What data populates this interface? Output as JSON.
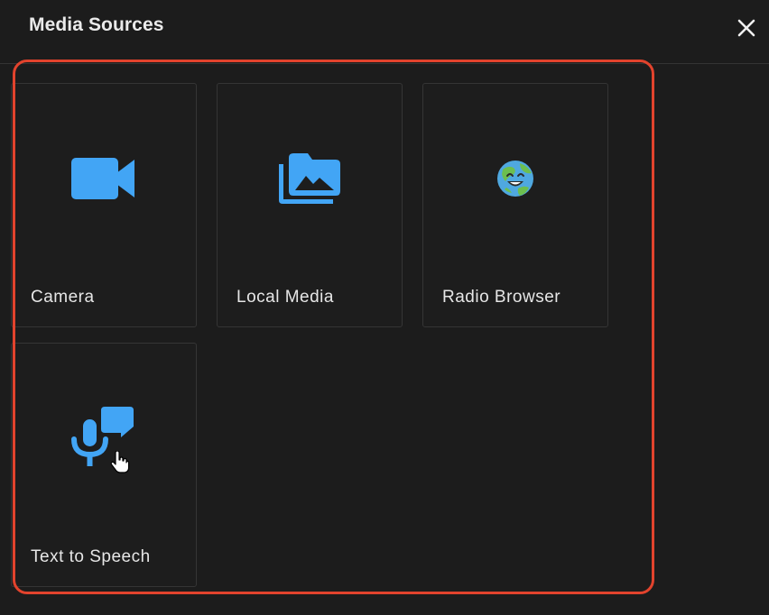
{
  "dialog": {
    "title": "Media Sources",
    "close_icon": "close-icon"
  },
  "sources": [
    {
      "label": "Camera",
      "icon": "videocam-icon"
    },
    {
      "label": "Local Media",
      "icon": "photo-library-icon"
    },
    {
      "label": "Radio Browser",
      "icon": "earth-globe-smiling-icon"
    },
    {
      "label": "Text to Speech",
      "icon": "record-voice-icon"
    }
  ],
  "colors": {
    "background": "#1c1c1c",
    "card_border": "#353535",
    "icon_blue": "#42a5f5",
    "highlight": "#e2432d",
    "text": "#e6e6e6"
  }
}
